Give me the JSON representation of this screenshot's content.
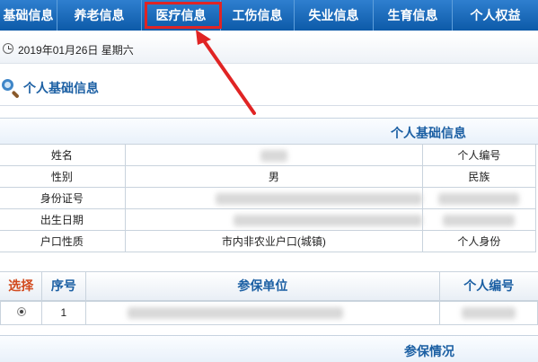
{
  "nav": {
    "items": [
      "基础信息",
      "养老信息",
      "医疗信息",
      "工伤信息",
      "失业信息",
      "生育信息",
      "个人权益"
    ],
    "active_index": 2
  },
  "date_text": "2019年01月26日 星期六",
  "section_title": "个人基础信息",
  "info_table": {
    "header": "个人基础信息",
    "rows": [
      {
        "label": "姓名",
        "value": "",
        "label2": "个人编号"
      },
      {
        "label": "性别",
        "value": "男",
        "label2": "民族"
      },
      {
        "label": "身份证号",
        "value": "",
        "label2": ""
      },
      {
        "label": "出生日期",
        "value": "",
        "label2": ""
      },
      {
        "label": "户口性质",
        "value": "市内非农业户口(城镇)",
        "label2": "个人身份"
      }
    ]
  },
  "grid": {
    "headers": {
      "select": "选择",
      "seq": "序号",
      "unit": "参保单位",
      "id": "个人编号"
    },
    "rows": [
      {
        "seq": "1"
      }
    ]
  },
  "insurance_header": "参保情况",
  "colors": {
    "nav": "#0d5aa8",
    "highlight": "#e02424",
    "title": "#1b5fa3",
    "select_header": "#d24a1e"
  }
}
